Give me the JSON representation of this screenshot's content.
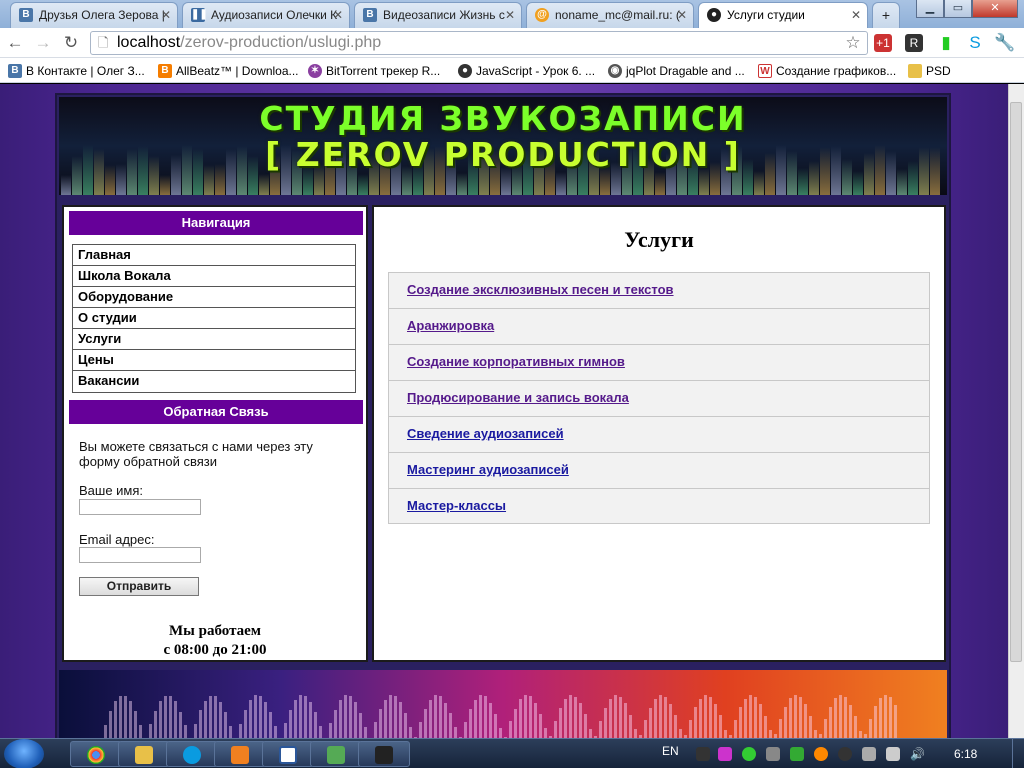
{
  "browser": {
    "tabs": [
      {
        "label": "Друзья Олега Зерова |",
        "icon": "vk-icon"
      },
      {
        "label": "Аудиозаписи Олечки К",
        "icon": "pause-icon"
      },
      {
        "label": "Видеозаписи Жизнь с",
        "icon": "vk-icon"
      },
      {
        "label": "noname_mc@mail.ru: (",
        "icon": "mail-icon"
      },
      {
        "label": "Услуги студии",
        "icon": "incognito-icon",
        "active": true
      }
    ],
    "url_host": "localhost",
    "url_path": "/zerov-production/uslugi.php",
    "bookmarks": [
      {
        "label": "В Контакте | Олег З...",
        "icon": "vk-icon"
      },
      {
        "label": "AllBeatz™ | Downloa...",
        "icon": "blogger-icon"
      },
      {
        "label": "BitTorrent трекер R...",
        "icon": "bittorrent-icon"
      },
      {
        "label": "JavaScript - Урок 6. ...",
        "icon": "globe-icon"
      },
      {
        "label": "jqPlot Dragable and ...",
        "icon": "github-icon"
      },
      {
        "label": "Создание графиков...",
        "icon": "w-icon"
      },
      {
        "label": "PSD",
        "icon": "folder-icon"
      }
    ]
  },
  "site": {
    "banner_line1": "СТУДИЯ ЗВУКОЗАПИСИ",
    "banner_line2": "[ ZEROV PRODUCTION ]",
    "nav_header": "Навигация",
    "nav_items": [
      "Главная",
      "Школа Вокала",
      "Оборудование",
      "О студии",
      "Услуги",
      "Цены",
      "Вакансии"
    ],
    "feedback_header": "Обратная Связь",
    "feedback_text": "Вы можете связаться с нами через эту форму обратной связи",
    "name_label": "Ваше имя:",
    "email_label": "Email адрес:",
    "send_label": "Отправить",
    "hours_line1": "Мы работаем",
    "hours_line2": "с 08:00 до 21:00",
    "services_title": "Услуги",
    "services": [
      "Создание эксклюзивных песен и текстов",
      "Аранжировка",
      "Создание корпоративных гимнов",
      "Продюсирование и запись вокала",
      "Сведение аудиозаписей",
      "Мастеринг аудиозаписей",
      "Мастер-классы"
    ]
  },
  "taskbar": {
    "lang": "EN",
    "time": "6:18"
  },
  "colors": {
    "nav_header_bg": "#660099",
    "link": "#1a1aa0",
    "visited": "#551a8b"
  }
}
